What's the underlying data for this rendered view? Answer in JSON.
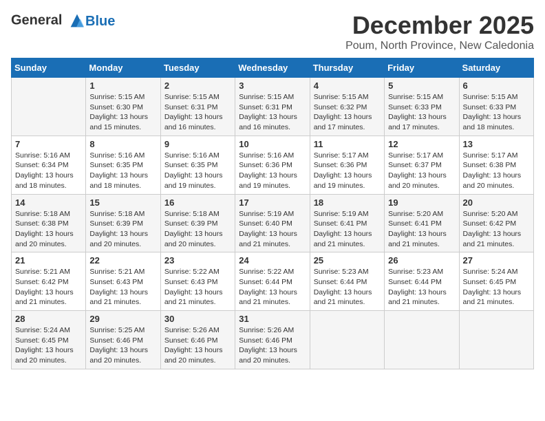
{
  "logo": {
    "line1": "General",
    "line2": "Blue"
  },
  "title": "December 2025",
  "location": "Poum, North Province, New Caledonia",
  "days_of_week": [
    "Sunday",
    "Monday",
    "Tuesday",
    "Wednesday",
    "Thursday",
    "Friday",
    "Saturday"
  ],
  "weeks": [
    [
      {
        "day": "",
        "info": ""
      },
      {
        "day": "1",
        "info": "Sunrise: 5:15 AM\nSunset: 6:30 PM\nDaylight: 13 hours\nand 15 minutes."
      },
      {
        "day": "2",
        "info": "Sunrise: 5:15 AM\nSunset: 6:31 PM\nDaylight: 13 hours\nand 16 minutes."
      },
      {
        "day": "3",
        "info": "Sunrise: 5:15 AM\nSunset: 6:31 PM\nDaylight: 13 hours\nand 16 minutes."
      },
      {
        "day": "4",
        "info": "Sunrise: 5:15 AM\nSunset: 6:32 PM\nDaylight: 13 hours\nand 17 minutes."
      },
      {
        "day": "5",
        "info": "Sunrise: 5:15 AM\nSunset: 6:33 PM\nDaylight: 13 hours\nand 17 minutes."
      },
      {
        "day": "6",
        "info": "Sunrise: 5:15 AM\nSunset: 6:33 PM\nDaylight: 13 hours\nand 18 minutes."
      }
    ],
    [
      {
        "day": "7",
        "info": "Sunrise: 5:16 AM\nSunset: 6:34 PM\nDaylight: 13 hours\nand 18 minutes."
      },
      {
        "day": "8",
        "info": "Sunrise: 5:16 AM\nSunset: 6:35 PM\nDaylight: 13 hours\nand 18 minutes."
      },
      {
        "day": "9",
        "info": "Sunrise: 5:16 AM\nSunset: 6:35 PM\nDaylight: 13 hours\nand 19 minutes."
      },
      {
        "day": "10",
        "info": "Sunrise: 5:16 AM\nSunset: 6:36 PM\nDaylight: 13 hours\nand 19 minutes."
      },
      {
        "day": "11",
        "info": "Sunrise: 5:17 AM\nSunset: 6:36 PM\nDaylight: 13 hours\nand 19 minutes."
      },
      {
        "day": "12",
        "info": "Sunrise: 5:17 AM\nSunset: 6:37 PM\nDaylight: 13 hours\nand 20 minutes."
      },
      {
        "day": "13",
        "info": "Sunrise: 5:17 AM\nSunset: 6:38 PM\nDaylight: 13 hours\nand 20 minutes."
      }
    ],
    [
      {
        "day": "14",
        "info": "Sunrise: 5:18 AM\nSunset: 6:38 PM\nDaylight: 13 hours\nand 20 minutes."
      },
      {
        "day": "15",
        "info": "Sunrise: 5:18 AM\nSunset: 6:39 PM\nDaylight: 13 hours\nand 20 minutes."
      },
      {
        "day": "16",
        "info": "Sunrise: 5:18 AM\nSunset: 6:39 PM\nDaylight: 13 hours\nand 20 minutes."
      },
      {
        "day": "17",
        "info": "Sunrise: 5:19 AM\nSunset: 6:40 PM\nDaylight: 13 hours\nand 21 minutes."
      },
      {
        "day": "18",
        "info": "Sunrise: 5:19 AM\nSunset: 6:41 PM\nDaylight: 13 hours\nand 21 minutes."
      },
      {
        "day": "19",
        "info": "Sunrise: 5:20 AM\nSunset: 6:41 PM\nDaylight: 13 hours\nand 21 minutes."
      },
      {
        "day": "20",
        "info": "Sunrise: 5:20 AM\nSunset: 6:42 PM\nDaylight: 13 hours\nand 21 minutes."
      }
    ],
    [
      {
        "day": "21",
        "info": "Sunrise: 5:21 AM\nSunset: 6:42 PM\nDaylight: 13 hours\nand 21 minutes."
      },
      {
        "day": "22",
        "info": "Sunrise: 5:21 AM\nSunset: 6:43 PM\nDaylight: 13 hours\nand 21 minutes."
      },
      {
        "day": "23",
        "info": "Sunrise: 5:22 AM\nSunset: 6:43 PM\nDaylight: 13 hours\nand 21 minutes."
      },
      {
        "day": "24",
        "info": "Sunrise: 5:22 AM\nSunset: 6:44 PM\nDaylight: 13 hours\nand 21 minutes."
      },
      {
        "day": "25",
        "info": "Sunrise: 5:23 AM\nSunset: 6:44 PM\nDaylight: 13 hours\nand 21 minutes."
      },
      {
        "day": "26",
        "info": "Sunrise: 5:23 AM\nSunset: 6:44 PM\nDaylight: 13 hours\nand 21 minutes."
      },
      {
        "day": "27",
        "info": "Sunrise: 5:24 AM\nSunset: 6:45 PM\nDaylight: 13 hours\nand 21 minutes."
      }
    ],
    [
      {
        "day": "28",
        "info": "Sunrise: 5:24 AM\nSunset: 6:45 PM\nDaylight: 13 hours\nand 20 minutes."
      },
      {
        "day": "29",
        "info": "Sunrise: 5:25 AM\nSunset: 6:46 PM\nDaylight: 13 hours\nand 20 minutes."
      },
      {
        "day": "30",
        "info": "Sunrise: 5:26 AM\nSunset: 6:46 PM\nDaylight: 13 hours\nand 20 minutes."
      },
      {
        "day": "31",
        "info": "Sunrise: 5:26 AM\nSunset: 6:46 PM\nDaylight: 13 hours\nand 20 minutes."
      },
      {
        "day": "",
        "info": ""
      },
      {
        "day": "",
        "info": ""
      },
      {
        "day": "",
        "info": ""
      }
    ]
  ]
}
